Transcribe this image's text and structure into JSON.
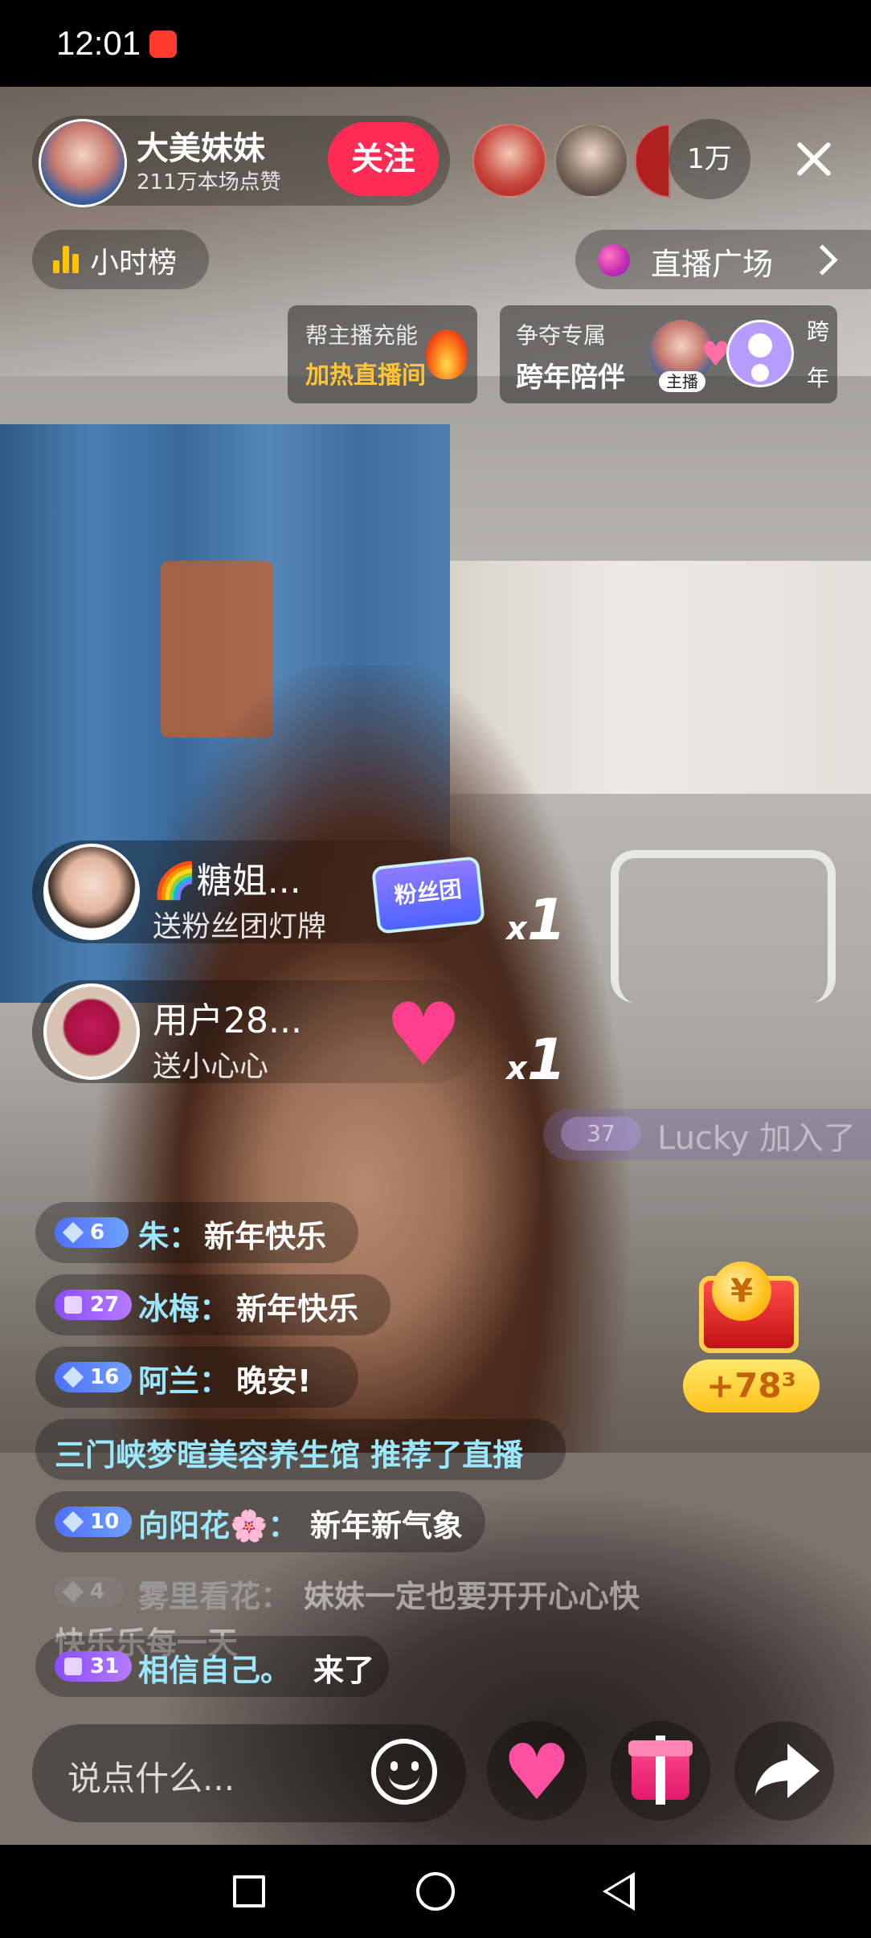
{
  "status_bar": {
    "time": "12:01"
  },
  "host": {
    "name": "大美妹妹",
    "likes": "211万本场点赞",
    "follow_label": "关注"
  },
  "viewers": {
    "count": "1万"
  },
  "top_row": {
    "hourly_rank_label": "小时榜",
    "plaza_label": "直播广场"
  },
  "promo_cards": {
    "boost": {
      "line1": "帮主播充能",
      "line2": "加热直播间"
    },
    "new_year": {
      "line1": "争夺专属",
      "line2": "跨年陪伴",
      "host_tag": "主播",
      "side_label_1": "跨",
      "side_label_2": "年"
    }
  },
  "gifts": [
    {
      "user": "🌈糖姐...",
      "text": "送粉丝团灯牌",
      "badge_label": "粉丝团",
      "count_prefix": "x",
      "count": "1"
    },
    {
      "user": "用户28...",
      "text": "送小心心",
      "count_prefix": "x",
      "count": "1"
    }
  ],
  "join_notice": {
    "level": "37",
    "text": "Lucky 加入了"
  },
  "chat": [
    {
      "level": "6",
      "user": "朱：",
      "message": "新年快乐"
    },
    {
      "level": "27",
      "user": "冰梅：",
      "message": "新年快乐"
    },
    {
      "level": "16",
      "user": "阿兰：",
      "message": "晚安!"
    },
    {
      "system": "三门峡梦暄美容养生馆 推荐了直播"
    },
    {
      "level": "10",
      "user": "向阳花🌸：",
      "message": "新年新气象"
    },
    {
      "level": "4",
      "user": "雾里看花：",
      "message": "妹妹一定也要开开心心快",
      "message_cont": "快乐乐每一天"
    },
    {
      "level": "31",
      "user": "相信自己。",
      "message": "来了"
    }
  ],
  "treasure": {
    "coin_symbol": "¥",
    "counter": "+78³"
  },
  "bottom_bar": {
    "input_placeholder": "说点什么..."
  },
  "colors": {
    "follow": "#fe2c55",
    "username": "#9be7ff",
    "boost_highlight": "#ffc534"
  },
  "icons": [
    "close-icon",
    "bar-chart-icon",
    "plaza-icon",
    "fire-icon",
    "heart-icon",
    "emoji-icon",
    "gift-icon",
    "share-icon",
    "nav-back-icon",
    "nav-home-icon",
    "nav-recent-icon"
  ]
}
